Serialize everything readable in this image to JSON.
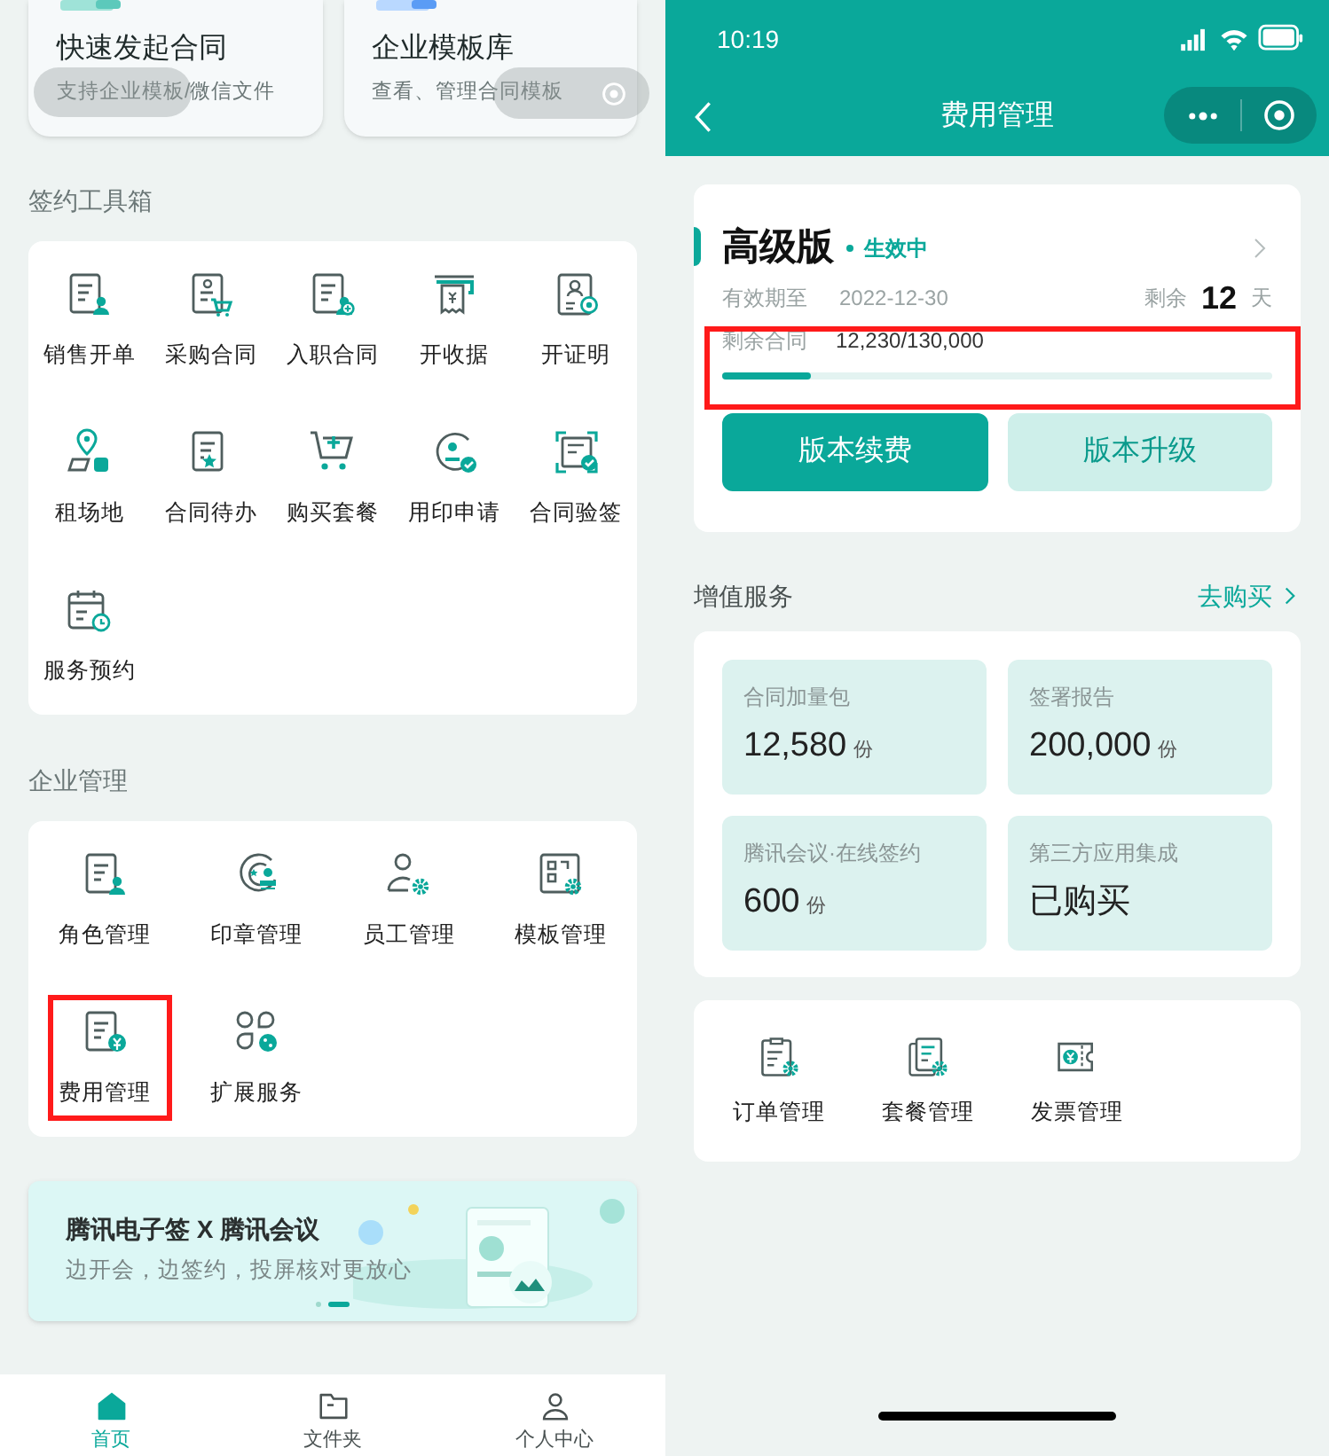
{
  "left_screen": {
    "quick_cards": [
      {
        "title": "快速发起合同",
        "subtitle": "支持企业模板/微信文件"
      },
      {
        "title": "企业模板库",
        "subtitle": "查看、管理合同模板"
      }
    ],
    "toolbox": {
      "title": "签约工具箱",
      "items": [
        {
          "label": "销售开单",
          "highlighted": false
        },
        {
          "label": "采购合同",
          "highlighted": false
        },
        {
          "label": "入职合同",
          "highlighted": false
        },
        {
          "label": "开收据",
          "highlighted": false
        },
        {
          "label": "开证明",
          "highlighted": false
        },
        {
          "label": "租场地",
          "highlighted": false
        },
        {
          "label": "合同待办",
          "highlighted": false
        },
        {
          "label": "购买套餐",
          "highlighted": false
        },
        {
          "label": "用印申请",
          "highlighted": false
        },
        {
          "label": "合同验签",
          "highlighted": false
        },
        {
          "label": "服务预约",
          "highlighted": false
        }
      ]
    },
    "enterprise": {
      "title": "企业管理",
      "items": [
        {
          "label": "角色管理",
          "highlighted": false
        },
        {
          "label": "印章管理",
          "highlighted": false
        },
        {
          "label": "员工管理",
          "highlighted": false
        },
        {
          "label": "模板管理",
          "highlighted": false
        },
        {
          "label": "费用管理",
          "highlighted": true
        },
        {
          "label": "扩展服务",
          "highlighted": false
        }
      ]
    },
    "banner": {
      "title": "腾讯电子签 X 腾讯会议",
      "subtitle": "边开会，边签约，投屏核对更放心",
      "dots": [
        {
          "selected": false
        },
        {
          "selected": true
        }
      ]
    },
    "tab_bar": [
      {
        "label": "首页",
        "selected": true
      },
      {
        "label": "文件夹",
        "selected": false
      },
      {
        "label": "个人中心",
        "selected": false
      }
    ]
  },
  "right_screen": {
    "status_bar": {
      "time": "10:19"
    },
    "nav": {
      "title": "费用管理"
    },
    "plan": {
      "name": "高级版",
      "status": "生效中",
      "expiry_label": "有效期至",
      "expiry": "2022-12-30",
      "remaining_label": "剩余",
      "remaining_days": "12",
      "days_unit": "天",
      "contracts_label": "剩余合同",
      "contracts": "12,230/130,000",
      "level": 0.16,
      "highlighted": true,
      "buttons": [
        {
          "label": "版本续费",
          "kind": "primary"
        },
        {
          "label": "版本升级",
          "kind": "secondary"
        }
      ]
    },
    "services": {
      "title": "增值服务",
      "link": "去购买",
      "tiles": [
        {
          "label": "合同加量包",
          "value": "12,580",
          "unit": "份"
        },
        {
          "label": "签署报告",
          "value": "200,000",
          "unit": "份"
        },
        {
          "label": "腾讯会议·在线签约",
          "value": "600",
          "unit": "份"
        },
        {
          "label": "第三方应用集成",
          "value": "已购买"
        }
      ]
    },
    "tools": [
      {
        "label": "订单管理"
      },
      {
        "label": "套餐管理"
      },
      {
        "label": "发票管理"
      }
    ]
  }
}
